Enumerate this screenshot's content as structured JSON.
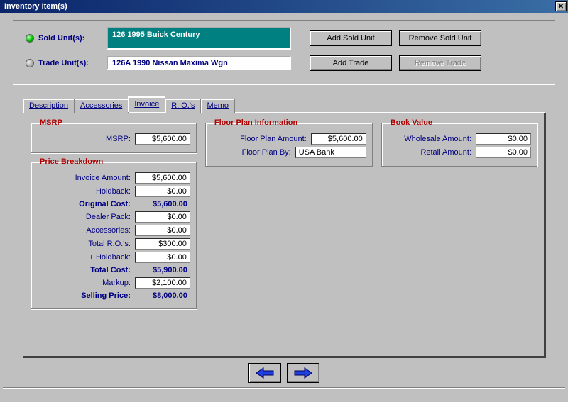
{
  "window": {
    "title": "Inventory Item(s)"
  },
  "units": {
    "sold_label": "Sold Unit(s):",
    "sold_value": "126 1995 Buick Century",
    "trade_label": "Trade Unit(s):",
    "trade_value": "126A 1990 Nissan Maxima Wgn"
  },
  "buttons": {
    "add_sold": "Add Sold Unit",
    "remove_sold": "Remove Sold Unit",
    "add_trade": "Add Trade",
    "remove_trade": "Remove Trade"
  },
  "tabs": {
    "description": "Description",
    "accessories": "Accessories",
    "invoice": "Invoice",
    "ro": "R. O.'s",
    "memo": "Memo"
  },
  "groups": {
    "msrp_title": "MSRP",
    "price_title": "Price Breakdown",
    "floor_title": "Floor Plan Information",
    "book_title": "Book Value"
  },
  "msrp": {
    "msrp_label": "MSRP:",
    "msrp_value": "$5,600.00"
  },
  "price": {
    "invoice_label": "Invoice Amount:",
    "invoice_value": "$5,600.00",
    "holdback_label": "Holdback:",
    "holdback_value": "$0.00",
    "origcost_label": "Original Cost:",
    "origcost_value": "$5,600.00",
    "dealer_label": "Dealer Pack:",
    "dealer_value": "$0.00",
    "acc_label": "Accessories:",
    "acc_value": "$0.00",
    "ro_label": "Total R.O.'s:",
    "ro_value": "$300.00",
    "plushold_label": "+ Holdback:",
    "plushold_value": "$0.00",
    "total_label": "Total Cost:",
    "total_value": "$5,900.00",
    "markup_label": "Markup:",
    "markup_value": "$2,100.00",
    "sell_label": "Selling Price:",
    "sell_value": "$8,000.00"
  },
  "floor": {
    "amount_label": "Floor Plan Amount:",
    "amount_value": "$5,600.00",
    "by_label": "Floor Plan By:",
    "by_value": "USA Bank"
  },
  "book": {
    "wholesale_label": "Wholesale Amount:",
    "wholesale_value": "$0.00",
    "retail_label": "Retail Amount:",
    "retail_value": "$0.00"
  }
}
